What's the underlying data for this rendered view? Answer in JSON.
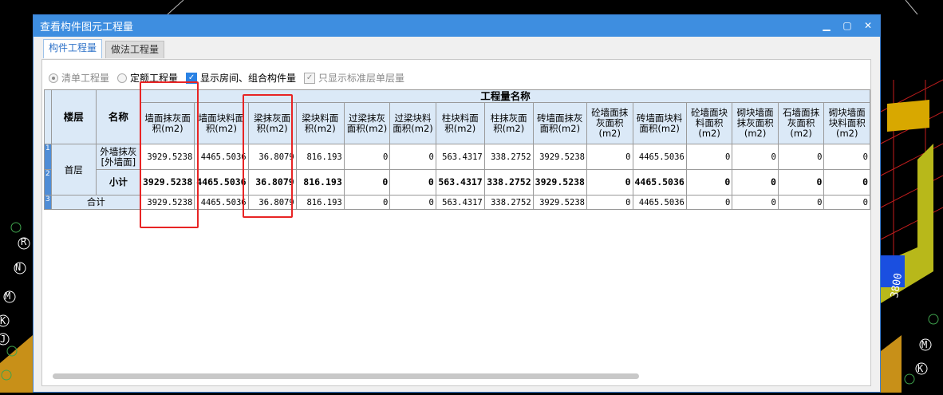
{
  "dialog": {
    "title": "查看构件图元工程量",
    "minimize": "▁",
    "maximize": "▢",
    "close": "✕"
  },
  "tabs": [
    "构件工程量",
    "做法工程量"
  ],
  "options": {
    "radio1": "清单工程量",
    "radio2": "定额工程量",
    "check1": "显示房间、组合构件量",
    "check2": "只显示标准层单层量"
  },
  "table": {
    "group_header": "工程量名称",
    "col_floor": "楼层",
    "col_name": "名称",
    "columns": [
      "墙面抹灰面积(m2)",
      "墙面块料面积(m2)",
      "梁抹灰面积(m2)",
      "梁块料面积(m2)",
      "过梁抹灰面积(m2)",
      "过梁块料面积(m2)",
      "柱块料面积(m2)",
      "柱抹灰面积(m2)",
      "砖墙面抹灰面积(m2)",
      "砼墙面抹灰面积(m2)",
      "砖墙面块料面积(m2)",
      "砼墙面块料面积(m2)",
      "砌块墙面抹灰面积(m2)",
      "石墙面抹灰面积(m2)",
      "砌块墙面块料面积(m2)"
    ],
    "floor_value": "首层",
    "row1_name": "外墙抹灰[外墙面]",
    "row2_name": "小计",
    "row3_name": "合计",
    "row_numbers": [
      "1",
      "2",
      "3"
    ],
    "row1": [
      "3929.5238",
      "4465.5036",
      "36.8079",
      "816.193",
      "0",
      "0",
      "563.4317",
      "338.2752",
      "3929.5238",
      "0",
      "4465.5036",
      "0",
      "0",
      "0",
      "0"
    ],
    "row2": [
      "3929.5238",
      "4465.5036",
      "36.8079",
      "816.193",
      "0",
      "0",
      "563.4317",
      "338.2752",
      "3929.5238",
      "0",
      "4465.5036",
      "0",
      "0",
      "0",
      "0"
    ],
    "row3": [
      "3929.5238",
      "4465.5036",
      "36.8079",
      "816.193",
      "0",
      "0",
      "563.4317",
      "338.2752",
      "3929.5238",
      "0",
      "4465.5036",
      "0",
      "0",
      "0",
      "0"
    ]
  },
  "cad_labels": [
    "R",
    "N",
    "M",
    "K",
    "J",
    "3800",
    "M",
    "K"
  ],
  "colors": {
    "titlebar": "#3e8ee0",
    "header": "#dbe9f7",
    "highlight": "#e82424",
    "rownum": "#4f8dd6"
  }
}
